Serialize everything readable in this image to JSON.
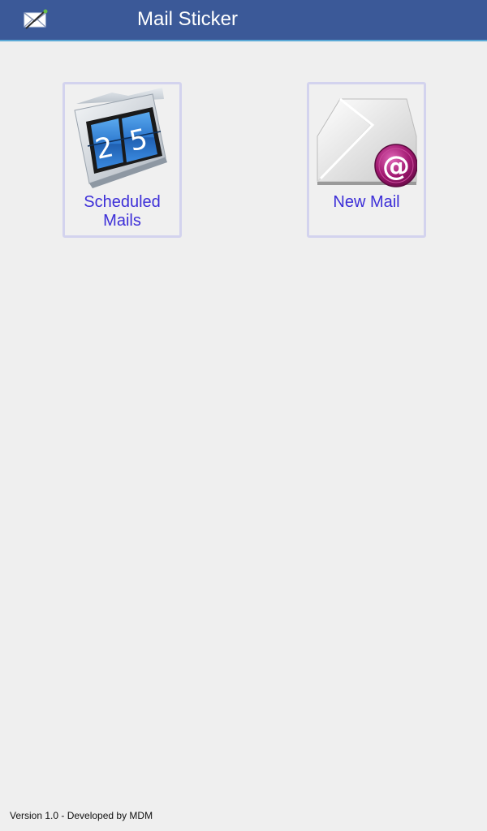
{
  "header": {
    "title": "Mail Sticker",
    "app_icon": "mail-sticker-icon",
    "background_color": "#3b5998",
    "accent_color": "#5aa9d6"
  },
  "tiles": [
    {
      "label_line1": "Scheduled",
      "label_line2": "Mails",
      "icon": "calendar-folder-icon",
      "icon_digits": [
        "2",
        "5"
      ]
    },
    {
      "label_line1": "New Mail",
      "icon": "envelope-at-icon",
      "icon_symbol": "@"
    }
  ],
  "footer": {
    "text": "Version 1.0 - Developed by MDM"
  },
  "colors": {
    "tile_label": "#3d2fd8",
    "tile_border": "#d3d3ee",
    "background": "#efefef"
  }
}
